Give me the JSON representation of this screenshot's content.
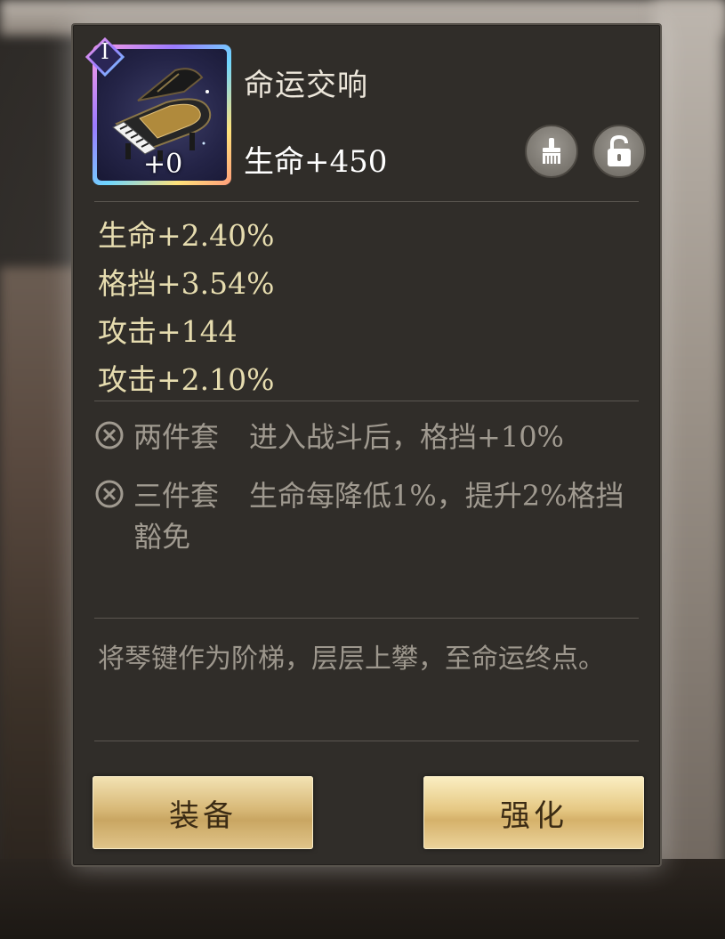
{
  "item": {
    "name": "命运交响",
    "tier": "I",
    "level": "+0",
    "main_stat": "生命+450",
    "icon": "grand-piano"
  },
  "actions_top": {
    "brush_icon": "brush-icon",
    "lock_icon": "unlock-icon"
  },
  "sub_stats": [
    "生命+2.40%",
    "格挡+3.54%",
    "攻击+144",
    "攻击+2.10%"
  ],
  "set_bonuses": [
    {
      "name": "两件套",
      "effect": "进入战斗后，格挡+10%"
    },
    {
      "name": "三件套",
      "effect": "生命每降低1%，提升2%格挡豁免"
    }
  ],
  "flavor_text": "将琴键作为阶梯，层层上攀，至命运终点。",
  "buttons": {
    "equip": "装备",
    "upgrade": "强化"
  },
  "colors": {
    "panel_bg": "#302d29",
    "sub_stat_text": "#e6dcaf",
    "set_text": "#a09a90",
    "button_gold": "#d8b978"
  }
}
